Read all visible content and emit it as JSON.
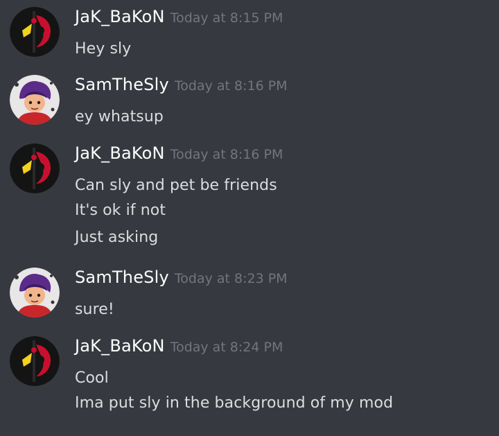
{
  "messages": [
    {
      "author": "JaK_BaKoN",
      "avatar_icon": "jak-bakon-avatar-icon",
      "time": "Today at 8:15 PM",
      "lines": [
        "Hey sly"
      ]
    },
    {
      "author": "SamTheSly",
      "avatar_icon": "samthesly-avatar-icon",
      "time": "Today at 8:16 PM",
      "lines": [
        "ey whatsup"
      ]
    },
    {
      "author": "JaK_BaKoN",
      "avatar_icon": "jak-bakon-avatar-icon",
      "time": "Today at 8:16 PM",
      "lines": [
        "Can sly and pet be friends",
        "It's ok if not",
        "Just asking"
      ]
    },
    {
      "author": "SamTheSly",
      "avatar_icon": "samthesly-avatar-icon",
      "time": "Today at 8:23 PM",
      "lines": [
        "sure!"
      ]
    },
    {
      "author": "JaK_BaKoN",
      "avatar_icon": "jak-bakon-avatar-icon",
      "time": "Today at 8:24 PM",
      "lines": [
        "Cool",
        "Ima put sly in the background of my mod"
      ]
    }
  ],
  "colors": {
    "background": "#36393f",
    "username": "#ffffff",
    "timestamp": "#72767d",
    "message_text": "#dcddde"
  }
}
